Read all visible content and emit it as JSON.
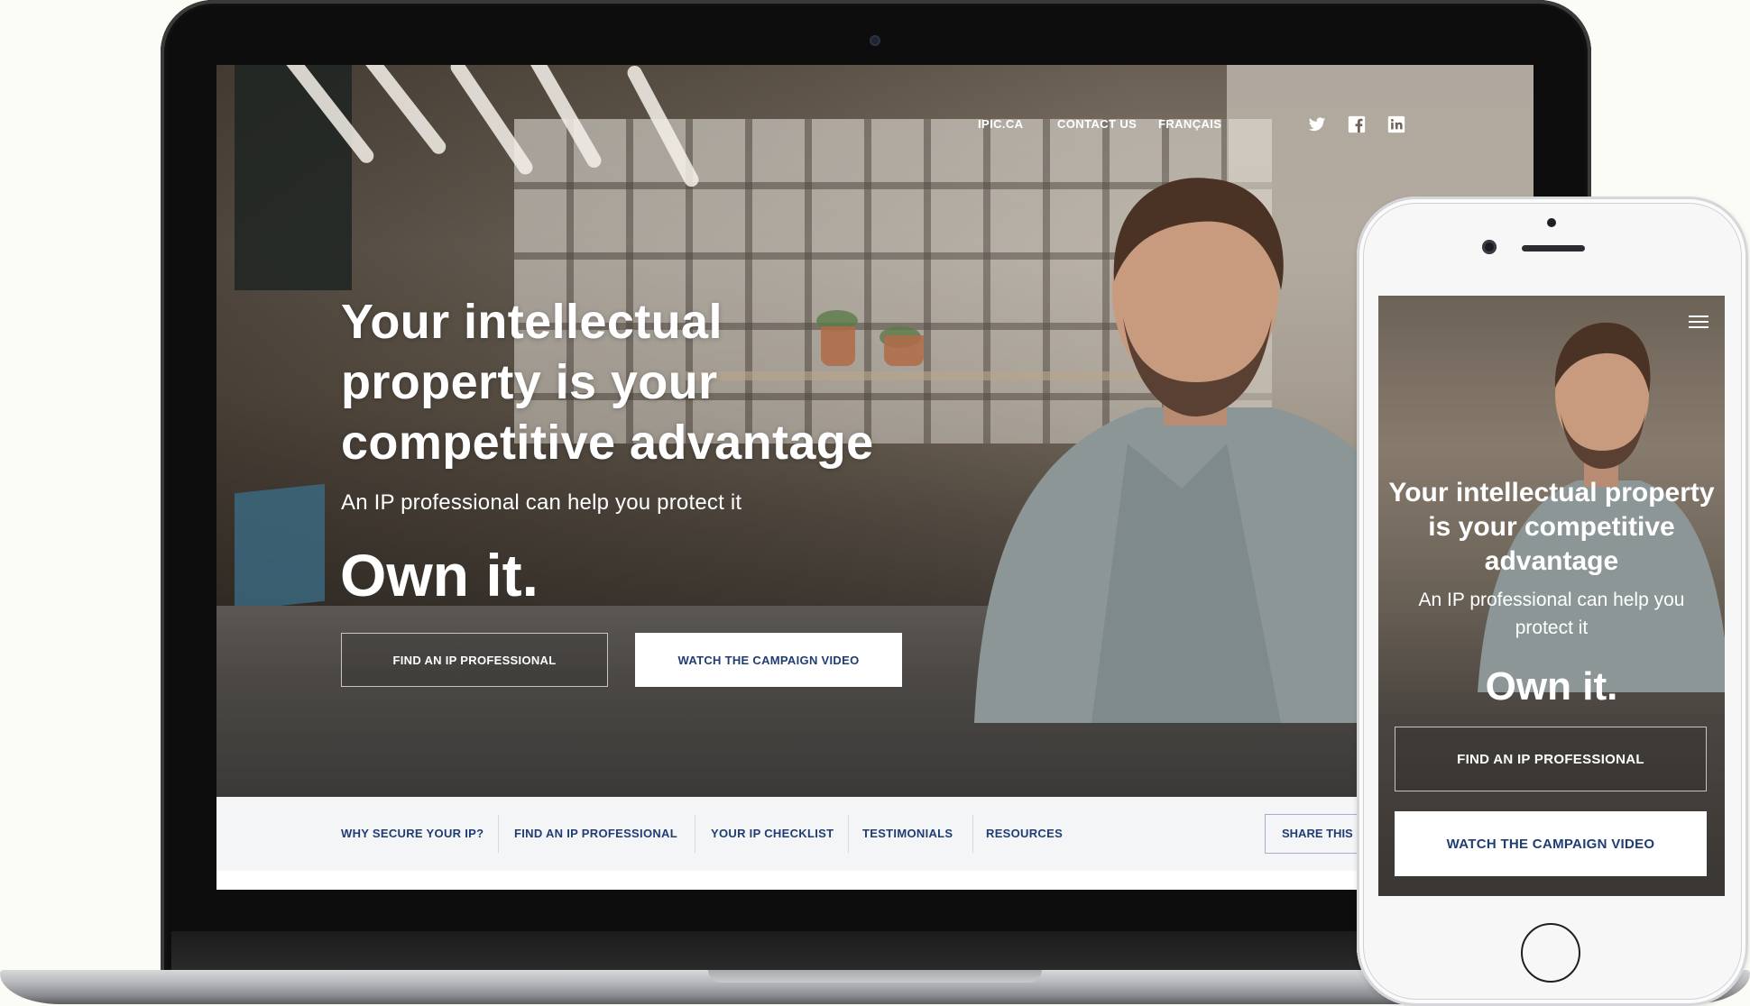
{
  "desktop": {
    "nav": {
      "links": [
        "IPIC.CA",
        "CONTACT US",
        "FRANÇAIS"
      ],
      "social": [
        "twitter-icon",
        "facebook-icon",
        "linkedin-icon"
      ]
    },
    "hero": {
      "title": "Your intellectual property is your competitive advantage",
      "subtitle": "An IP professional can help you protect it",
      "tagline": "Own it.",
      "primary_button": "FIND AN IP PROFESSIONAL",
      "secondary_button": "WATCH THE CAMPAIGN VIDEO"
    },
    "subnav": {
      "items": [
        "WHY SECURE YOUR IP?",
        "FIND AN IP PROFESSIONAL",
        "YOUR IP CHECKLIST",
        "TESTIMONIALS",
        "RESOURCES"
      ],
      "share_label": "SHARE THIS"
    }
  },
  "mobile": {
    "menu_icon": "hamburger-menu-icon",
    "hero": {
      "title": "Your intellectual property is your competitive advantage",
      "subtitle": "An IP professional can help you protect it",
      "tagline": "Own it.",
      "primary_button": "FIND AN IP PROFESSIONAL",
      "secondary_button": "WATCH THE CAMPAIGN VIDEO"
    }
  },
  "colors": {
    "brand_navy": "#1f3d73",
    "subnav_bg": "#f4f5f7",
    "white": "#ffffff"
  }
}
